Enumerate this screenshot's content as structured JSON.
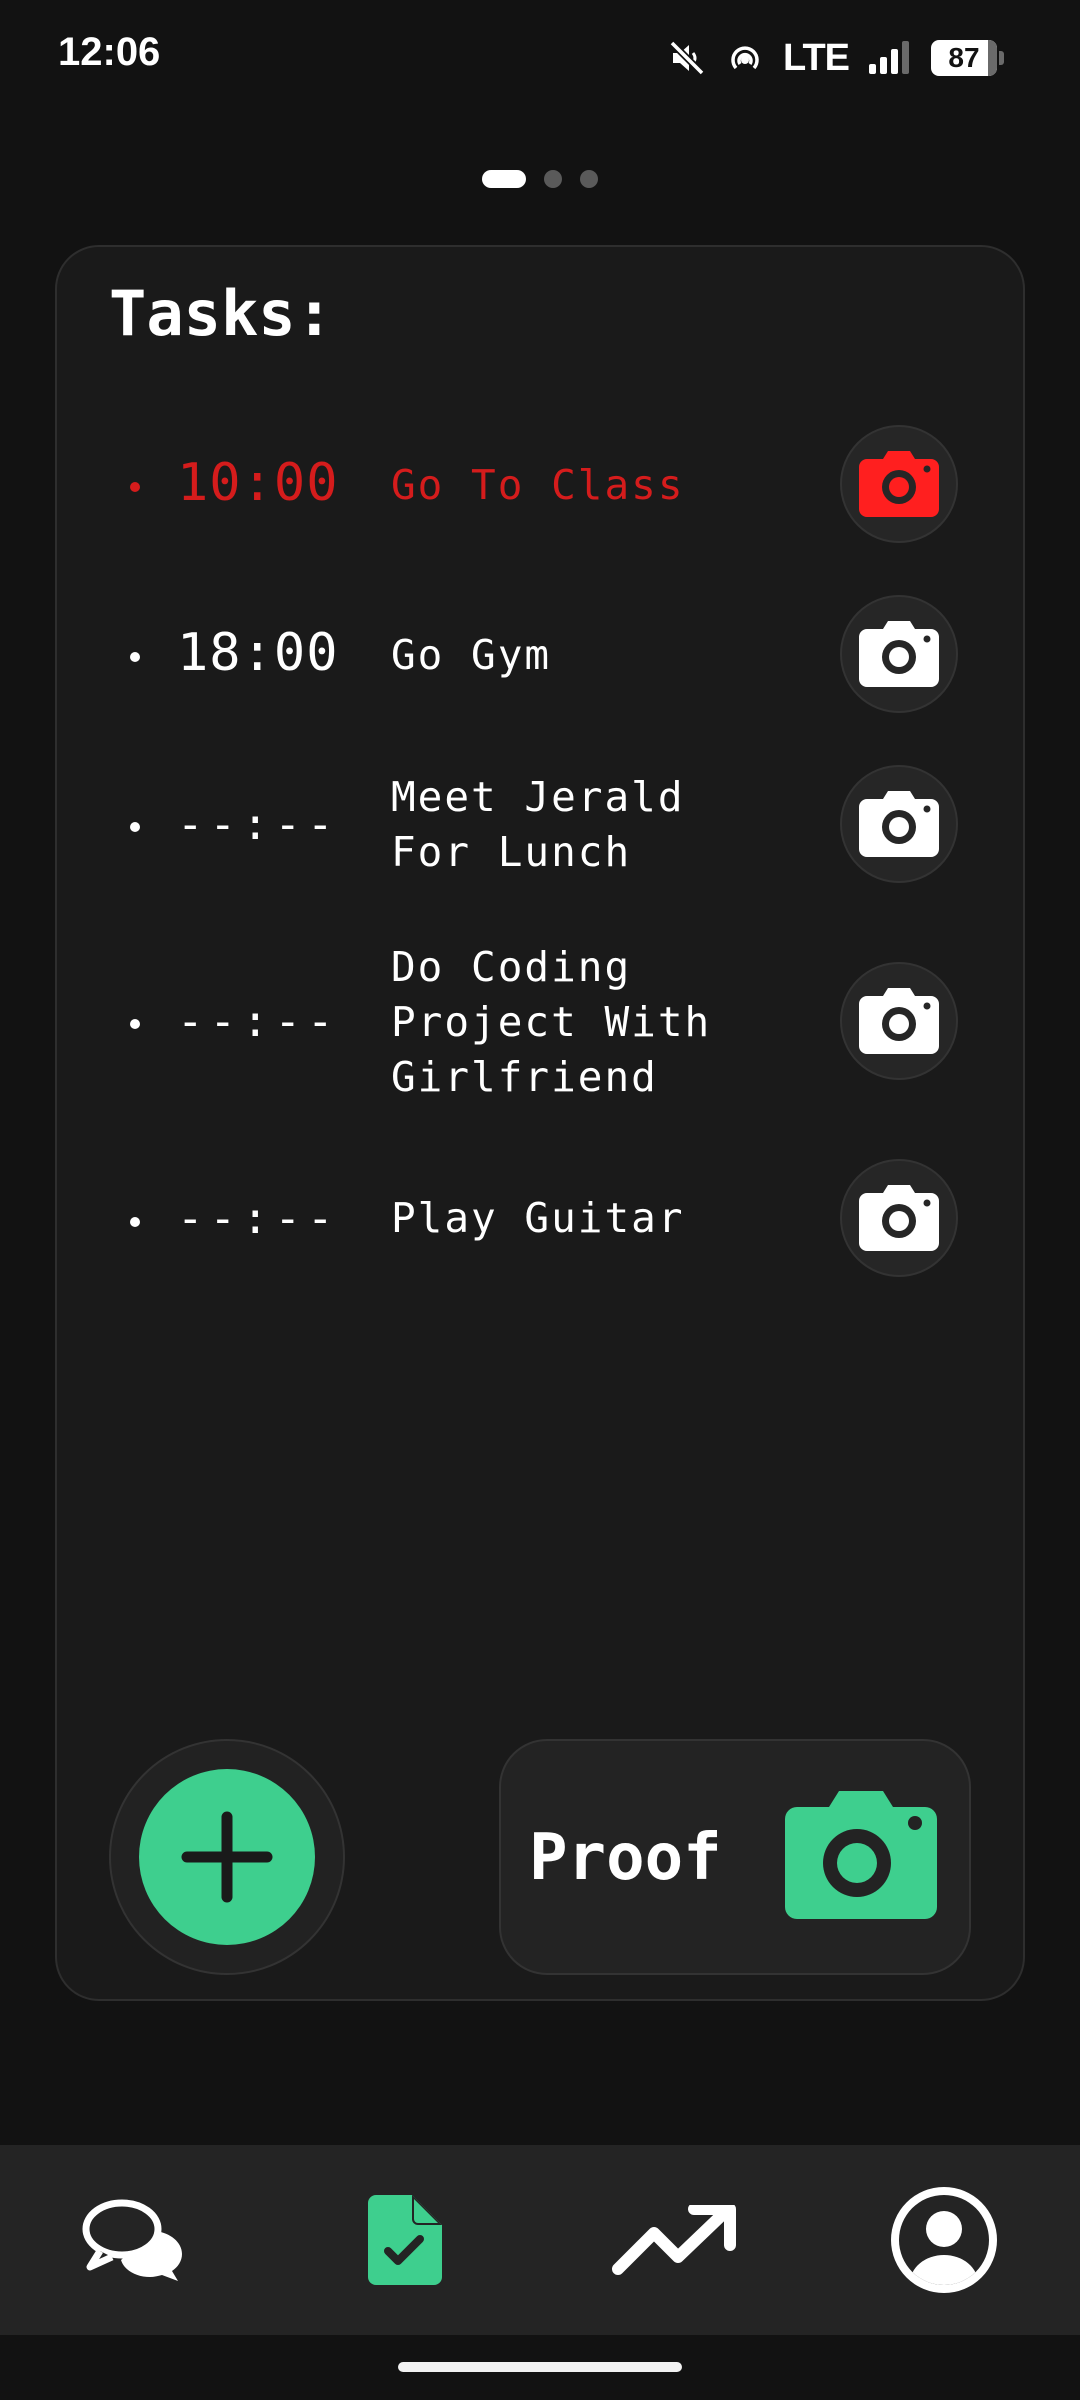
{
  "status_bar": {
    "time": "12:06",
    "network": "LTE",
    "battery_percent": "87",
    "battery_level": 0.87,
    "icons": [
      "mute-icon",
      "hotspot-icon",
      "signal-icon",
      "battery-icon"
    ]
  },
  "pager": {
    "page_count": 3,
    "active_index": 0
  },
  "tasks_card": {
    "title": "Tasks:",
    "tasks": [
      {
        "time": "10:00",
        "name": "Go To Class",
        "status": "overdue",
        "icon": "camera-icon"
      },
      {
        "time": "18:00",
        "name": "Go Gym",
        "status": "normal",
        "icon": "camera-icon"
      },
      {
        "time": "--:--",
        "name": "Meet Jerald For Lunch",
        "status": "normal",
        "icon": "camera-icon"
      },
      {
        "time": "--:--",
        "name": "Do Coding Project With Girlfriend",
        "status": "normal",
        "icon": "camera-icon"
      },
      {
        "time": "--:--",
        "name": "Play Guitar",
        "status": "normal",
        "icon": "camera-icon"
      }
    ],
    "add_button_icon": "plus-icon",
    "proof_button": {
      "label": "Proof",
      "icon": "camera-icon"
    }
  },
  "bottom_nav": {
    "items": [
      {
        "icon": "chat-bubbles-icon",
        "active": false
      },
      {
        "icon": "document-check-icon",
        "active": true
      },
      {
        "icon": "trending-up-icon",
        "active": false
      },
      {
        "icon": "profile-icon",
        "active": false
      }
    ]
  },
  "colors": {
    "background": "#121212",
    "card": "#1a1a1a",
    "accent_green": "#3ecf8e",
    "overdue_red": "#d51c1c",
    "nav_background": "#242424"
  }
}
